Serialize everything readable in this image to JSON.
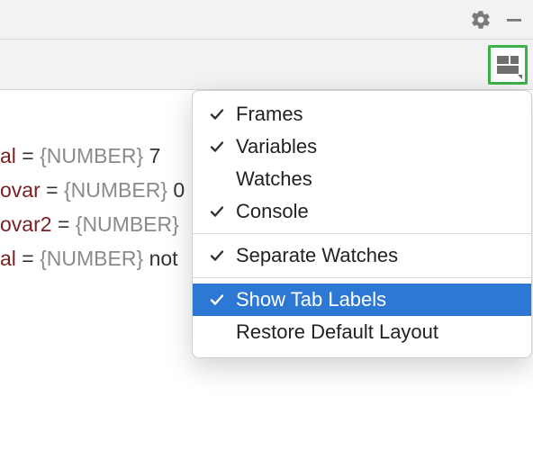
{
  "code": {
    "lines": [
      {
        "name": "al",
        "type": "{NUMBER}",
        "value": "7"
      },
      {
        "name": "ovar",
        "type": "{NUMBER}",
        "value": "0"
      },
      {
        "name": "ovar2",
        "type": "{NUMBER}",
        "value": ""
      },
      {
        "name": "al",
        "type": "{NUMBER}",
        "value": "not"
      }
    ]
  },
  "menu": {
    "items": [
      {
        "label": "Frames",
        "checked": true
      },
      {
        "label": "Variables",
        "checked": true
      },
      {
        "label": "Watches",
        "checked": false
      },
      {
        "label": "Console",
        "checked": true
      }
    ],
    "separate_watches": {
      "label": "Separate Watches",
      "checked": true
    },
    "show_tab_labels": {
      "label": "Show Tab Labels",
      "checked": true
    },
    "restore_layout": {
      "label": "Restore Default Layout"
    }
  }
}
